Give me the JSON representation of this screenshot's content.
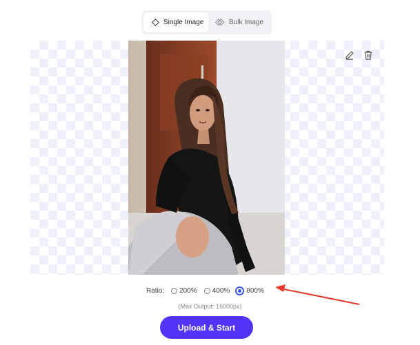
{
  "tabs": {
    "single_label": "Single Image",
    "bulk_label": "Bulk Image"
  },
  "canvas": {
    "photo_alt": "Woman with long brown hair in black top sitting on floor, reaching toward camera"
  },
  "ratio": {
    "label": "Ratio:",
    "options": [
      "200%",
      "400%",
      "800%"
    ],
    "selected": "800%"
  },
  "max_output": "(Max Output: 16000px)",
  "upload_button": "Upload & Start",
  "colors": {
    "accent": "#5332f5",
    "radio_selected": "#3c57e8",
    "arrow": "#e8372d"
  }
}
